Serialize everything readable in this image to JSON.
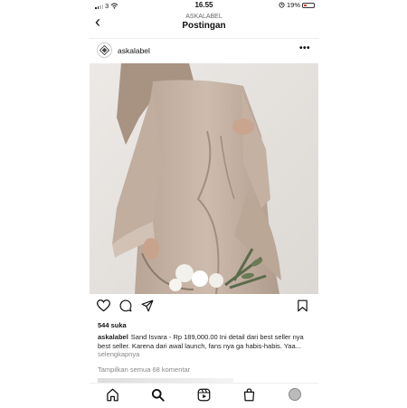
{
  "status_bar": {
    "carrier": "3",
    "time": "16.55",
    "battery": "19%"
  },
  "header": {
    "account": "ASKALABEL",
    "title": "Postingan"
  },
  "post": {
    "username": "askalabel",
    "likes": "544 suka",
    "caption_user": "askalabel",
    "caption_text": "Sand Isvara - Rp 189,000.00 Ini detail dari best seller nya best seller. Karena dari awal launch, fans nya ga habis-habis. Yaa...",
    "caption_more": "selengkapnya",
    "comments_link": "Tampilkan semua 68 komentar"
  },
  "icons": {
    "back": "chevron-left-icon",
    "more": "more-dots-icon",
    "like": "heart-icon",
    "comment": "comment-icon",
    "share": "send-icon",
    "save": "bookmark-icon",
    "tabs": [
      "home-icon",
      "search-icon",
      "reels-icon",
      "shop-icon",
      "profile-icon"
    ]
  },
  "colors": {
    "battery_low": "#e0352b",
    "text": "#111111",
    "muted": "#888888"
  }
}
